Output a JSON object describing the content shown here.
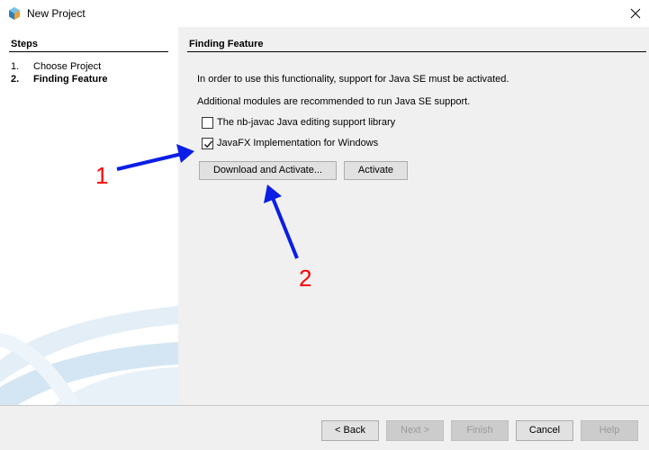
{
  "window": {
    "title": "New Project",
    "app_icon": "netbeans-icon",
    "close_icon": "close-icon"
  },
  "steps": {
    "heading": "Steps",
    "items": [
      {
        "num": "1.",
        "label": "Choose Project",
        "current": false
      },
      {
        "num": "2.",
        "label": "Finding Feature",
        "current": true
      }
    ]
  },
  "panel": {
    "title": "Finding Feature",
    "message1": "In order to use this functionality, support for Java SE must be activated.",
    "message2": "Additional modules are recommended to run Java SE support.",
    "checkboxes": [
      {
        "label": "The nb-javac Java editing support library",
        "checked": false
      },
      {
        "label": "JavaFX Implementation for Windows",
        "checked": true
      }
    ],
    "download_button": "Download and Activate...",
    "activate_button": "Activate"
  },
  "annotations": {
    "label1": "1",
    "label2": "2",
    "color": "#ff0000",
    "arrow_color": "#0a1ee6"
  },
  "footer": {
    "back": "< Back",
    "next": "Next >",
    "finish": "Finish",
    "cancel": "Cancel",
    "help": "Help"
  }
}
